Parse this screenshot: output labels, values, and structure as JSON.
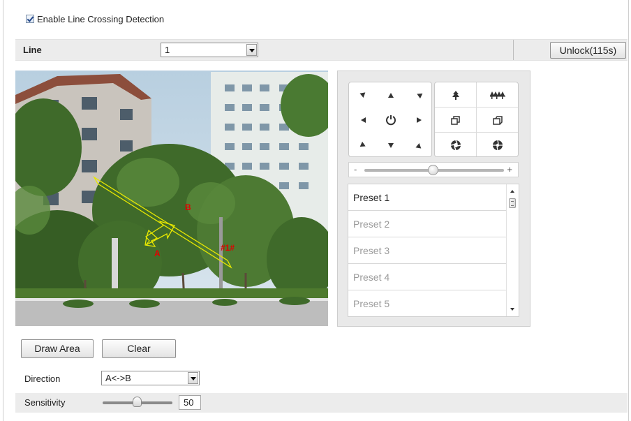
{
  "enable": {
    "label": "Enable Line Crossing Detection",
    "checked": true
  },
  "line": {
    "label": "Line",
    "selected": "1"
  },
  "unlock_button": "Unlock(115s)",
  "video": {
    "marker_a": "A",
    "marker_b": "B",
    "line_id": "#1#"
  },
  "ptz": {
    "icons": {
      "dpad": [
        "arrow-up-left-icon",
        "arrow-up-icon",
        "arrow-up-right-icon",
        "arrow-left-icon",
        "auto-rotate-icon",
        "arrow-right-icon",
        "arrow-down-left-icon",
        "arrow-down-icon",
        "arrow-down-right-icon"
      ],
      "zoom": [
        "zoom-in-icon",
        "zoom-out-icon",
        "focus-near-icon",
        "focus-far-icon",
        "iris-open-icon",
        "iris-close-icon"
      ]
    },
    "speed": {
      "minus": "-",
      "plus": "+",
      "level": 0.55
    },
    "presets": [
      "Preset 1",
      "Preset 2",
      "Preset 3",
      "Preset 4",
      "Preset 5"
    ]
  },
  "buttons": {
    "draw_area": "Draw Area",
    "clear": "Clear"
  },
  "direction": {
    "label": "Direction",
    "selected": "A<->B"
  },
  "sensitivity": {
    "label": "Sensitivity",
    "value": "50"
  },
  "colors": {
    "detection_line": "#e8e800",
    "marker_text": "#e00000",
    "row_bg": "#ececec"
  }
}
